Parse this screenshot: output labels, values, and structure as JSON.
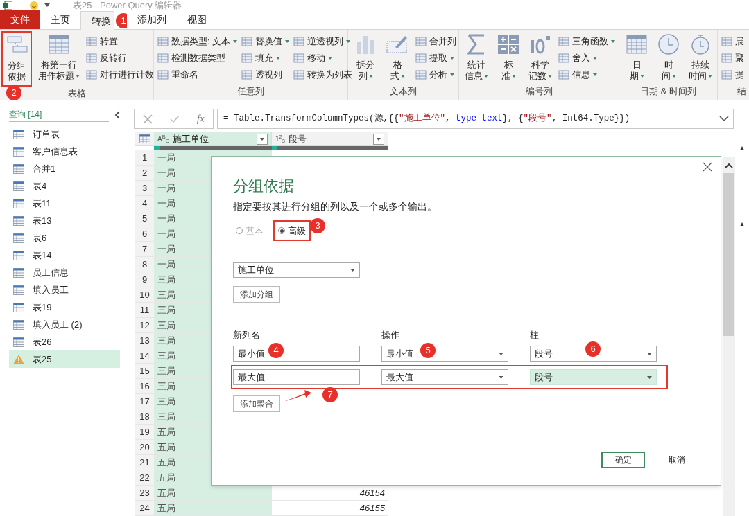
{
  "window": {
    "title": "表25 - Power Query 编辑器"
  },
  "tabs": [
    {
      "label": "文件",
      "kind": "file",
      "selected": false
    },
    {
      "label": "主页",
      "kind": "tab",
      "selected": false
    },
    {
      "label": "转换",
      "kind": "tab",
      "selected": true
    },
    {
      "label": "添加列",
      "kind": "tab",
      "selected": false
    },
    {
      "label": "视图",
      "kind": "tab",
      "selected": false
    }
  ],
  "ribbon": {
    "groups": [
      {
        "label": "表格",
        "items": [
          {
            "kind": "large",
            "lines": [
              "分组",
              "依据"
            ],
            "dropdown": false
          },
          {
            "kind": "large",
            "lines": [
              "将第一行",
              "用作标题"
            ],
            "dropdown": true
          },
          {
            "kind": "stack",
            "items": [
              {
                "label": "转置",
                "dropdown": false
              },
              {
                "label": "反转行",
                "dropdown": false
              },
              {
                "label": "对行进行计数",
                "dropdown": false
              }
            ]
          }
        ]
      },
      {
        "label": "任意列",
        "items": [
          {
            "kind": "stack",
            "items": [
              {
                "label": "数据类型: 文本",
                "dropdown": true
              },
              {
                "label": "检测数据类型",
                "dropdown": false
              },
              {
                "label": "重命名",
                "dropdown": false
              }
            ]
          },
          {
            "kind": "stack",
            "items": [
              {
                "label": "替换值",
                "dropdown": true
              },
              {
                "label": "填充",
                "dropdown": true
              },
              {
                "label": "透视列",
                "dropdown": false
              }
            ]
          },
          {
            "kind": "stack",
            "items": [
              {
                "label": "逆透视列",
                "dropdown": true
              },
              {
                "label": "移动",
                "dropdown": true
              },
              {
                "label": "转换为列表",
                "dropdown": false
              }
            ]
          }
        ]
      },
      {
        "label": "文本列",
        "items": [
          {
            "kind": "large",
            "lines": [
              "拆分",
              "列"
            ],
            "dropdown": true
          },
          {
            "kind": "large",
            "lines": [
              "格",
              "式"
            ],
            "dropdown": true
          },
          {
            "kind": "stack",
            "items": [
              {
                "label": "合并列",
                "dropdown": false
              },
              {
                "label": "提取",
                "dropdown": true
              },
              {
                "label": "分析",
                "dropdown": true
              }
            ]
          }
        ]
      },
      {
        "label": "编号列",
        "items": [
          {
            "kind": "large",
            "lines": [
              "统计",
              "信息"
            ],
            "dropdown": true
          },
          {
            "kind": "large",
            "lines": [
              "标",
              "准"
            ],
            "dropdown": true
          },
          {
            "kind": "large",
            "lines": [
              "科学",
              "记数"
            ],
            "dropdown": true
          },
          {
            "kind": "stack",
            "items": [
              {
                "label": "三角函数",
                "dropdown": true
              },
              {
                "label": "舍入",
                "dropdown": true
              },
              {
                "label": "信息",
                "dropdown": true
              }
            ]
          }
        ]
      },
      {
        "label": "日期 & 时间列",
        "items": [
          {
            "kind": "large",
            "lines": [
              "日",
              "期"
            ],
            "dropdown": true
          },
          {
            "kind": "large",
            "lines": [
              "时",
              "间"
            ],
            "dropdown": true
          },
          {
            "kind": "large",
            "lines": [
              "持续",
              "时间"
            ],
            "dropdown": true
          }
        ]
      },
      {
        "label": "结",
        "items": [
          {
            "kind": "stack",
            "items": [
              {
                "label": "展",
                "dropdown": false
              },
              {
                "label": "聚",
                "dropdown": false
              },
              {
                "label": "提",
                "dropdown": false
              }
            ]
          }
        ]
      }
    ]
  },
  "sidebar": {
    "header": "查询 [14]",
    "items": [
      {
        "label": "订单表",
        "kind": "table",
        "selected": false
      },
      {
        "label": "客户信息表",
        "kind": "table",
        "selected": false
      },
      {
        "label": "合并1",
        "kind": "table",
        "selected": false
      },
      {
        "label": "表4",
        "kind": "table",
        "selected": false
      },
      {
        "label": "表11",
        "kind": "table",
        "selected": false
      },
      {
        "label": "表13",
        "kind": "table",
        "selected": false
      },
      {
        "label": "表6",
        "kind": "table",
        "selected": false
      },
      {
        "label": "表14",
        "kind": "table",
        "selected": false
      },
      {
        "label": "员工信息",
        "kind": "table",
        "selected": false
      },
      {
        "label": "填入员工",
        "kind": "table",
        "selected": false
      },
      {
        "label": "表19",
        "kind": "table",
        "selected": false
      },
      {
        "label": "填入员工 (2)",
        "kind": "table",
        "selected": false
      },
      {
        "label": "表26",
        "kind": "table",
        "selected": false
      },
      {
        "label": "表25",
        "kind": "warning",
        "selected": true
      }
    ]
  },
  "formula_bar": {
    "fx": "fx",
    "tokens": [
      {
        "text": "= Table.TransformColumnTypes(源,{{",
        "kind": "plain"
      },
      {
        "text": "\"施工单位\"",
        "kind": "string"
      },
      {
        "text": ", ",
        "kind": "plain"
      },
      {
        "text": "type text",
        "kind": "keyword"
      },
      {
        "text": "}, {",
        "kind": "plain"
      },
      {
        "text": "\"段号\"",
        "kind": "string"
      },
      {
        "text": ", Int64.Type}})",
        "kind": "plain"
      }
    ]
  },
  "table": {
    "columns": [
      {
        "type_label": "A$^{B}$$_{C}$",
        "name": "施工单位",
        "selected": true
      },
      {
        "type_label": "1$^{2}$$_{3}$",
        "name": "段号",
        "selected": false
      }
    ],
    "rows": [
      {
        "index": "1",
        "cells": [
          "一局"
        ]
      },
      {
        "index": "2",
        "cells": [
          "一局"
        ]
      },
      {
        "index": "3",
        "cells": [
          "一局"
        ]
      },
      {
        "index": "4",
        "cells": [
          "一局"
        ]
      },
      {
        "index": "5",
        "cells": [
          "一局"
        ]
      },
      {
        "index": "6",
        "cells": [
          "一局"
        ]
      },
      {
        "index": "7",
        "cells": [
          "一局"
        ]
      },
      {
        "index": "8",
        "cells": [
          "一局"
        ]
      },
      {
        "index": "9",
        "cells": [
          "三局"
        ]
      },
      {
        "index": "10",
        "cells": [
          "三局"
        ]
      },
      {
        "index": "11",
        "cells": [
          "三局"
        ]
      },
      {
        "index": "12",
        "cells": [
          "三局"
        ]
      },
      {
        "index": "13",
        "cells": [
          "三局"
        ]
      },
      {
        "index": "14",
        "cells": [
          "三局"
        ]
      },
      {
        "index": "15",
        "cells": [
          "三局"
        ]
      },
      {
        "index": "16",
        "cells": [
          "三局"
        ]
      },
      {
        "index": "17",
        "cells": [
          "三局"
        ]
      },
      {
        "index": "18",
        "cells": [
          "三局"
        ]
      },
      {
        "index": "19",
        "cells": [
          "五局"
        ]
      },
      {
        "index": "20",
        "cells": [
          "五局"
        ]
      },
      {
        "index": "21",
        "cells": [
          "五局"
        ]
      },
      {
        "index": "22",
        "cells": [
          "五局"
        ]
      },
      {
        "index": "23",
        "cells": [
          "五局",
          "46154"
        ]
      },
      {
        "index": "24",
        "cells": [
          "五局",
          "46155"
        ]
      }
    ]
  },
  "dialog": {
    "title": "分组依据",
    "description": "指定要按其进行分组的列以及一个或多个输出。",
    "modes": [
      {
        "label": "基本",
        "selected": false
      },
      {
        "label": "高级",
        "selected": true
      }
    ],
    "group_by": [
      {
        "value": "施工单位"
      }
    ],
    "add_group_button": "添加分组",
    "headers": [
      "新列名",
      "操作",
      "柱"
    ],
    "aggregations": [
      {
        "name": "最小值",
        "operation": "最小值",
        "column": "段号",
        "selected": false
      },
      {
        "name": "最大值",
        "operation": "最大值",
        "column": "段号",
        "selected": true
      }
    ],
    "add_aggregation_button": "添加聚合",
    "buttons": [
      {
        "label": "确定",
        "kind": "primary"
      },
      {
        "label": "取消",
        "kind": "secondary"
      }
    ]
  },
  "annotations": {
    "markers": [
      "1",
      "2",
      "3",
      "4",
      "5",
      "6",
      "7"
    ]
  }
}
